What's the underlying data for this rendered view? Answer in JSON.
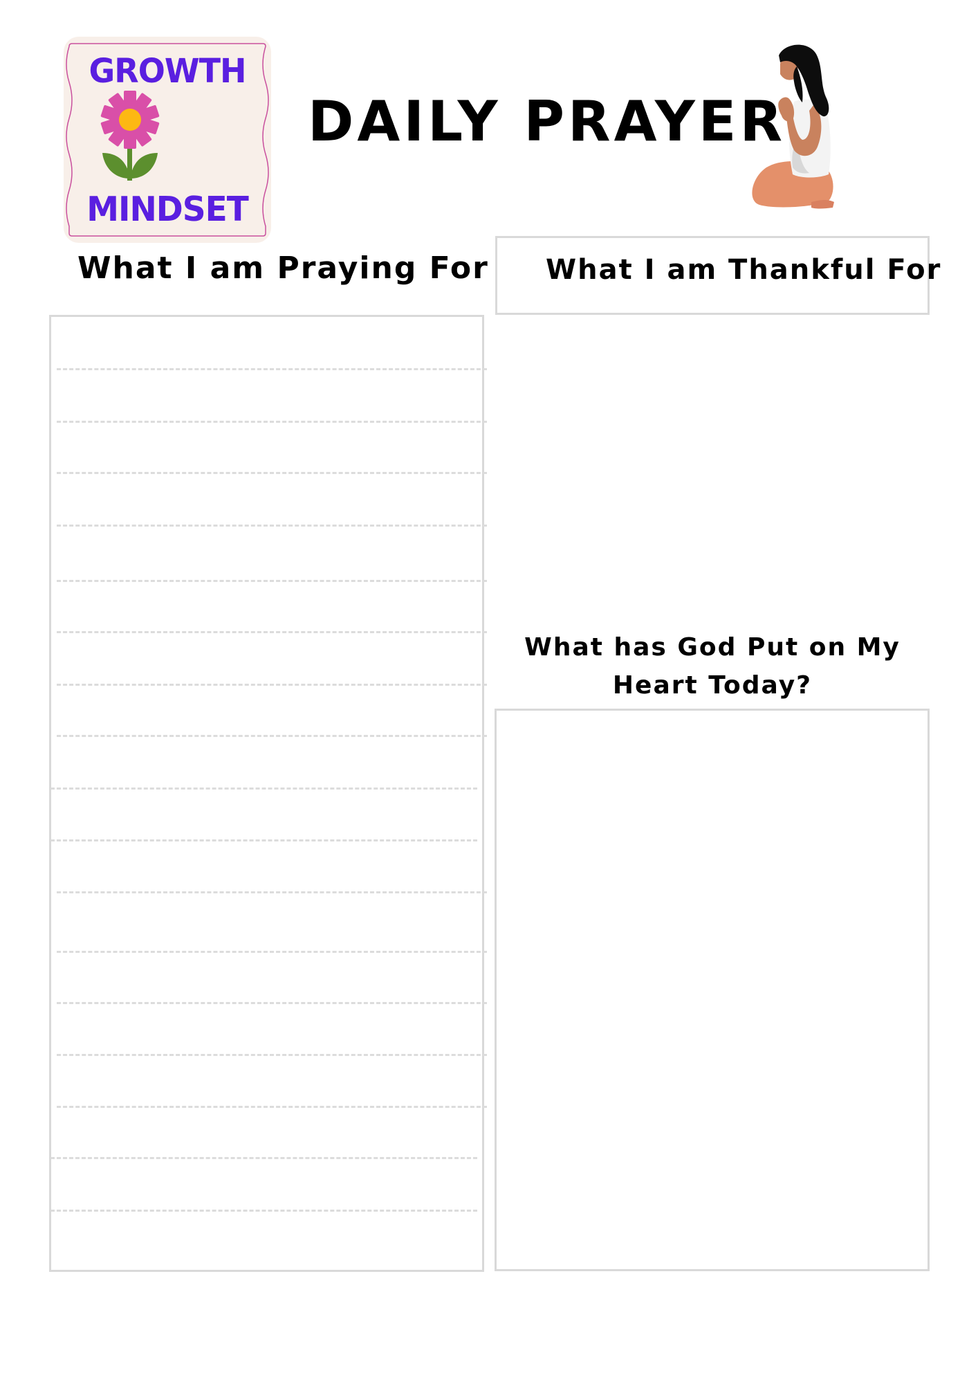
{
  "logo": {
    "top_word": "GROWTH",
    "bottom_word": "MINDSET",
    "icon": "flower-icon",
    "colors": {
      "background": "#F8EFE9",
      "border": "#C9509E",
      "text": "#5A1FE0",
      "petal": "#D94FA8",
      "center": "#FDB813",
      "stem": "#5C8F2E"
    }
  },
  "title": "DAILY PRAYER",
  "illustration": "praying-woman-icon",
  "sections": {
    "praying": {
      "heading": "What I am Praying For",
      "lines": 18
    },
    "thankful": {
      "heading": "What I am Thankful For"
    },
    "heart": {
      "heading": "What has God Put on My Heart Today?"
    }
  },
  "colors": {
    "border": "#d9d9d9",
    "dash": "#dcdcdc",
    "text": "#000000"
  }
}
